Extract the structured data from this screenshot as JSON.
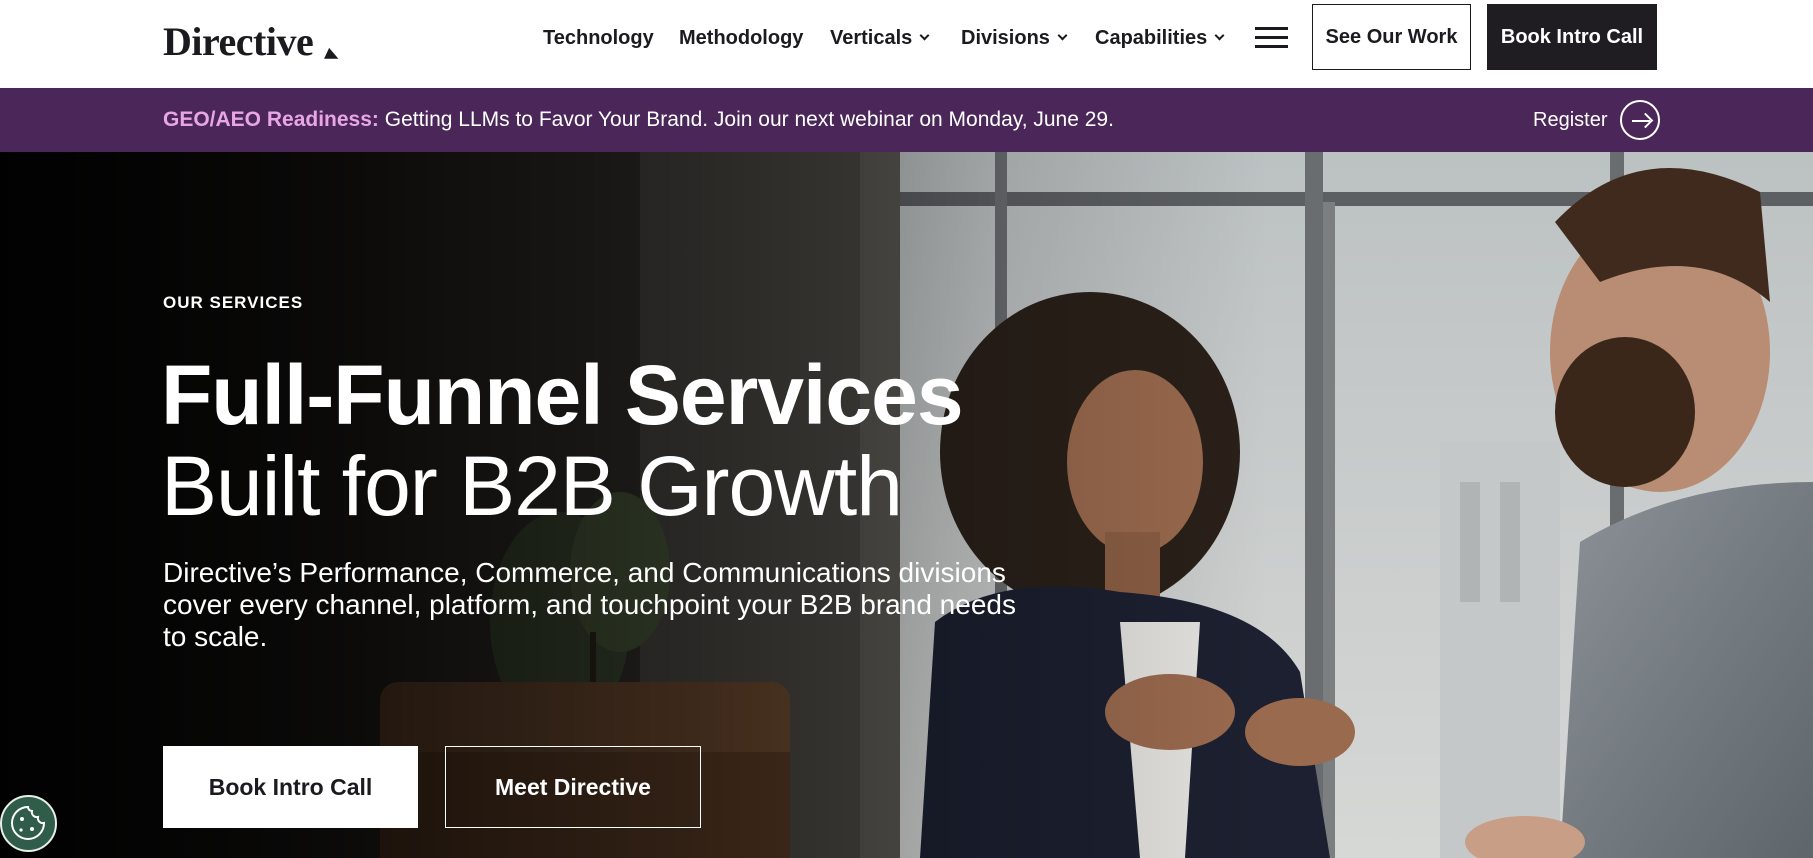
{
  "header": {
    "logo_text": "Directive",
    "nav": [
      {
        "label": "Technology",
        "has_dropdown": false
      },
      {
        "label": "Methodology",
        "has_dropdown": false
      },
      {
        "label": "Verticals",
        "has_dropdown": true
      },
      {
        "label": "Divisions",
        "has_dropdown": true
      },
      {
        "label": "Capabilities",
        "has_dropdown": true
      }
    ],
    "menu_icon": "hamburger-menu-icon",
    "see_work_label": "See Our Work",
    "book_call_label": "Book Intro Call"
  },
  "announcement": {
    "highlight": "GEO/AEO Readiness:",
    "text": " Getting LLMs to Favor Your Brand. Join our next webinar on Monday, June 29.",
    "register_label": "Register",
    "register_icon": "arrow-right-circle-icon"
  },
  "hero": {
    "eyebrow": "OUR SERVICES",
    "headline_bold": "Full-Funnel Services",
    "headline_regular": "Built for B2B Growth",
    "description": "Directive’s Performance, Commerce, and Communications divisions cover every channel, platform, and touchpoint your B2B brand needs to scale.",
    "primary_cta": "Book Intro Call",
    "secondary_cta": "Meet Directive",
    "cookie_icon": "cookie-icon"
  },
  "colors": {
    "announcement_bg": "#4b2658",
    "announcement_highlight": "#e9a6e6",
    "dark_button": "#1f1d22",
    "cookie_button": "#2f5d4a"
  }
}
